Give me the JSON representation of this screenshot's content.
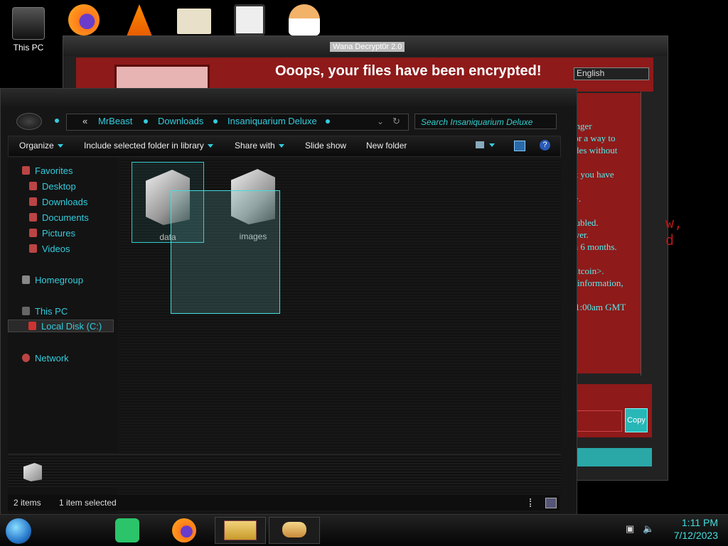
{
  "desktop": {
    "icons": [
      {
        "label": "This PC",
        "icon": "computer-icon"
      },
      {
        "label": "",
        "icon": "firefox-icon"
      },
      {
        "label": "",
        "icon": "vlc-icon"
      },
      {
        "label": "",
        "icon": "hxd-icon"
      },
      {
        "label": "",
        "icon": "app-icon"
      },
      {
        "label": "",
        "icon": "user-icon"
      }
    ]
  },
  "wannacry": {
    "title": "Wana Decrypt0r 2.0",
    "headline": "Ooops, your files have been encrypted!",
    "language": "English",
    "text_lines": [
      "onger",
      "for a way to",
      "files without",
      "",
      "ut you have",
      "",
      "t>.",
      "",
      "oubled.",
      "ever.",
      "in 6 months.",
      "",
      "bitcoin>.",
      "e information,",
      "",
      "11:00am GMT"
    ],
    "copy_label": "Copy"
  },
  "side_text": [
    "w,",
    "d"
  ],
  "explorer": {
    "breadcrumb": [
      "«",
      "MrBeast",
      "Downloads",
      "Insaniquarium Deluxe"
    ],
    "search_placeholder": "Search Insaniquarium Deluxe",
    "toolbar": {
      "organize": "Organize",
      "include": "Include selected folder in library",
      "share": "Share with",
      "slideshow": "Slide show",
      "newfolder": "New folder"
    },
    "nav": {
      "favorites": "Favorites",
      "desktop": "Desktop",
      "downloads": "Downloads",
      "documents": "Documents",
      "pictures": "Pictures",
      "videos": "Videos",
      "homegroup": "Homegroup",
      "thispc": "This PC",
      "localdisk": "Local Disk (C:)",
      "network": "Network"
    },
    "files": [
      {
        "name": "data",
        "selected": true
      },
      {
        "name": "images",
        "selected": false
      }
    ],
    "status": {
      "items": "2 items",
      "selected": "1 item selected"
    }
  },
  "taskbar": {
    "time": "1:11 PM",
    "date": "7/12/2023"
  }
}
